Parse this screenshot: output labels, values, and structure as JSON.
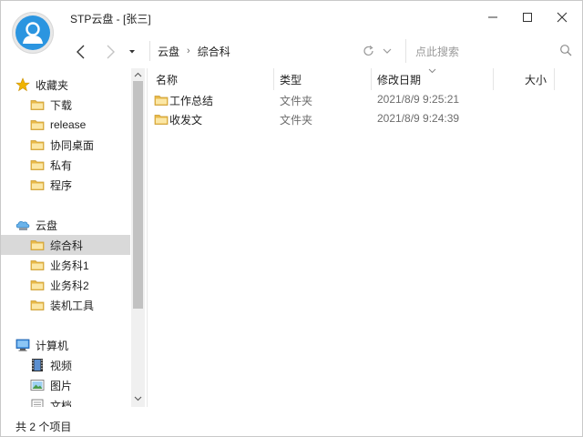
{
  "window": {
    "title": "STP云盘 - [张三]"
  },
  "nav": {
    "breadcrumb": [
      "云盘",
      "综合科"
    ],
    "search_placeholder": "点此搜索"
  },
  "sidebar": {
    "groups": [
      {
        "label": "收藏夹",
        "icon": "star-icon",
        "items": [
          {
            "label": "下载",
            "icon": "folder-icon"
          },
          {
            "label": "release",
            "icon": "folder-icon"
          },
          {
            "label": "协同桌面",
            "icon": "folder-icon"
          },
          {
            "label": "私有",
            "icon": "folder-icon"
          },
          {
            "label": "程序",
            "icon": "folder-icon"
          }
        ]
      },
      {
        "label": "云盘",
        "icon": "cloud-drive-icon",
        "items": [
          {
            "label": "综合科",
            "icon": "folder-icon",
            "selected": true
          },
          {
            "label": "业务科1",
            "icon": "folder-icon"
          },
          {
            "label": "业务科2",
            "icon": "folder-icon"
          },
          {
            "label": "装机工具",
            "icon": "folder-icon"
          }
        ]
      },
      {
        "label": "计算机",
        "icon": "computer-icon",
        "items": [
          {
            "label": "视频",
            "icon": "video-icon"
          },
          {
            "label": "图片",
            "icon": "picture-icon"
          },
          {
            "label": "文档",
            "icon": "document-icon"
          }
        ]
      }
    ]
  },
  "list": {
    "columns": [
      "名称",
      "类型",
      "修改日期",
      "大小"
    ],
    "rows": [
      {
        "name": "工作总结",
        "type": "文件夹",
        "modified": "2021/8/9 9:25:21",
        "size": ""
      },
      {
        "name": "收发文",
        "type": "文件夹",
        "modified": "2021/8/9 9:24:39",
        "size": ""
      }
    ]
  },
  "status": {
    "text": "共 2 个项目"
  },
  "colors": {
    "folder": "#e8b949",
    "selection": "#d9d9d9",
    "avatar": "#2b95e0"
  }
}
